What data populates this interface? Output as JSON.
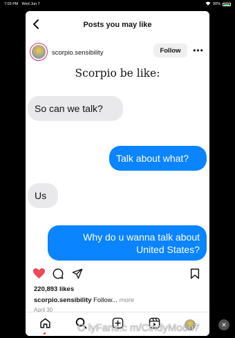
{
  "status_bar": {
    "time": "7:03 PM",
    "date": "Wed Jun 7",
    "battery": "90%"
  },
  "header": {
    "title": "Posts you may like"
  },
  "post": {
    "username": "scorpio.sensibility",
    "follow_label": "Follow",
    "more_label": "•••",
    "meme": {
      "title": "Scorpio be like:",
      "messages": [
        {
          "side": "in",
          "text": "So can we talk?"
        },
        {
          "side": "out",
          "text": "Talk about what?"
        },
        {
          "side": "in",
          "text": "Us"
        },
        {
          "side": "out",
          "text": "Why do u wanna talk about United States?"
        }
      ]
    },
    "likes": "220,893 likes",
    "caption_user": "scorpio.sensibility",
    "caption_text": "Follow...",
    "caption_more": "more",
    "date": "April 30"
  },
  "icons": {
    "back": "chevron-left-icon",
    "like": "heart-icon",
    "comment": "comment-icon",
    "share": "send-icon",
    "save": "bookmark-icon",
    "home": "home-icon",
    "search": "search-icon",
    "create": "plus-square-icon",
    "reels": "reels-icon",
    "profile": "avatar"
  },
  "colors": {
    "like": "#ed4956",
    "bubble_out": "#0a84ff",
    "bubble_in": "#e9e9eb"
  },
  "watermark": "O lyFans.c m/CindyMoon7",
  "close_glyph": "✕"
}
